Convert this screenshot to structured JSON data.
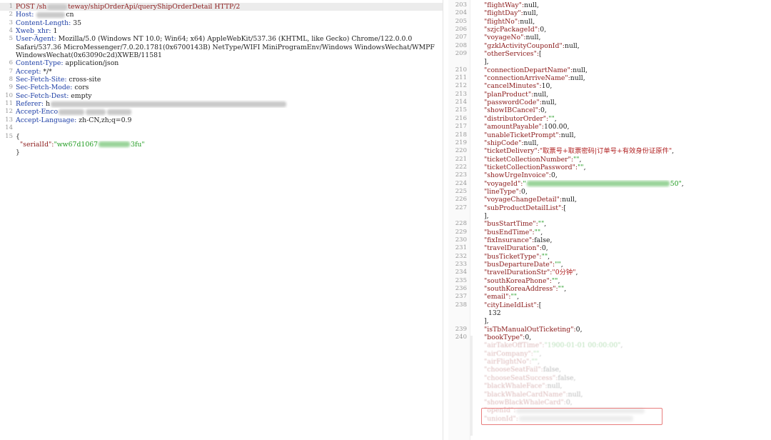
{
  "request": {
    "lines": [
      {
        "n": "1",
        "parts": [
          {
            "t": "POST /sh",
            "c": "k"
          },
          {
            "b": 28
          },
          {
            "t": "teway/shipOrderApi/queryShipOrderDetail HTTP/2",
            "c": "k"
          }
        ],
        "hl": true
      },
      {
        "n": "2",
        "parts": [
          {
            "t": "Host: ",
            "c": "hdr"
          },
          {
            "b": 40
          },
          {
            "t": "cn",
            "c": ""
          }
        ]
      },
      {
        "n": "3",
        "parts": [
          {
            "t": "Content-Length: ",
            "c": "hdr"
          },
          {
            "t": "35",
            "c": ""
          }
        ]
      },
      {
        "n": "4",
        "parts": [
          {
            "t": "Xweb_xhr: ",
            "c": "hdr"
          },
          {
            "t": "1",
            "c": ""
          }
        ]
      },
      {
        "n": "5",
        "parts": [
          {
            "t": "User-Agent: ",
            "c": "hdr"
          },
          {
            "t": "Mozilla/5.0 (Windows NT 10.0; Win64; x64) AppleWebKit/537.36 (KHTML, like Gecko) Chrome/122.0.0.0",
            "c": ""
          }
        ]
      },
      {
        "n": "",
        "parts": [
          {
            "t": "Safari/537.36 MicroMessenger/7.0.20.1781(0x6700143B) NetType/WIFI MiniProgramEnv/Windows WindowsWechat/WMPF",
            "c": ""
          }
        ]
      },
      {
        "n": "",
        "parts": [
          {
            "t": "WindowsWechat(0x63090c2d)XWEB/11581",
            "c": ""
          }
        ]
      },
      {
        "n": "6",
        "parts": [
          {
            "t": "Content-Type: ",
            "c": "hdr"
          },
          {
            "t": "application/json",
            "c": ""
          }
        ]
      },
      {
        "n": "7",
        "parts": [
          {
            "t": "Accept: ",
            "c": "hdr"
          },
          {
            "t": "*/*",
            "c": ""
          }
        ]
      },
      {
        "n": "8",
        "parts": [
          {
            "t": "Sec-Fetch-Site: ",
            "c": "hdr"
          },
          {
            "t": "cross-site",
            "c": ""
          }
        ]
      },
      {
        "n": "9",
        "parts": [
          {
            "t": "Sec-Fetch-Mode: ",
            "c": "hdr"
          },
          {
            "t": "cors",
            "c": ""
          }
        ]
      },
      {
        "n": "10",
        "parts": [
          {
            "t": "Sec-Fetch-Dest: ",
            "c": "hdr"
          },
          {
            "t": "empty",
            "c": ""
          }
        ]
      },
      {
        "n": "11",
        "parts": [
          {
            "t": "Referer: ",
            "c": "hdr"
          },
          {
            "t": "h",
            "c": ""
          },
          {
            "b": 330
          }
        ]
      },
      {
        "n": "12",
        "parts": [
          {
            "t": "Accept-Enco",
            "c": "hdr"
          },
          {
            "b": 36
          },
          {
            "b": 28
          },
          {
            "b": 34
          }
        ]
      },
      {
        "n": "13",
        "parts": [
          {
            "t": "Accept-Language: ",
            "c": "hdr"
          },
          {
            "t": "zh-CN,zh;q=0.9",
            "c": ""
          }
        ]
      },
      {
        "n": "14",
        "parts": []
      },
      {
        "n": "15",
        "parts": [
          {
            "t": "{",
            "c": ""
          }
        ]
      },
      {
        "n": "",
        "parts": [
          {
            "t": "  \"serialId\":",
            "c": "k"
          },
          {
            "t": "\"ww67d1067",
            "c": "s"
          },
          {
            "b": 44,
            "g": true
          },
          {
            "t": "3fu\"",
            "c": "s"
          }
        ]
      },
      {
        "n": "",
        "parts": [
          {
            "t": "}",
            "c": ""
          }
        ]
      }
    ]
  },
  "response": {
    "lines": [
      {
        "n": "203",
        "parts": [
          {
            "t": "\"flightWay\":",
            "c": "k"
          },
          {
            "t": "null,",
            "c": ""
          }
        ]
      },
      {
        "n": "204",
        "parts": [
          {
            "t": "\"flightDay\":",
            "c": "k"
          },
          {
            "t": "null,",
            "c": ""
          }
        ]
      },
      {
        "n": "205",
        "parts": [
          {
            "t": "\"flightNo\":",
            "c": "k"
          },
          {
            "t": "null,",
            "c": ""
          }
        ]
      },
      {
        "n": "206",
        "parts": [
          {
            "t": "\"szjcPackageId\":",
            "c": "k"
          },
          {
            "t": "0,",
            "c": ""
          }
        ]
      },
      {
        "n": "207",
        "parts": [
          {
            "t": "\"voyageNo\":",
            "c": "k"
          },
          {
            "t": "null,",
            "c": ""
          }
        ]
      },
      {
        "n": "208",
        "parts": [
          {
            "t": "\"gzklActivityCouponId\":",
            "c": "k"
          },
          {
            "t": "null,",
            "c": ""
          }
        ]
      },
      {
        "n": "209",
        "parts": [
          {
            "t": "\"otherServices\":",
            "c": "k"
          },
          {
            "t": "[",
            "c": ""
          }
        ]
      },
      {
        "n": "",
        "parts": [
          {
            "t": "],",
            "c": ""
          }
        ]
      },
      {
        "n": "210",
        "parts": [
          {
            "t": "\"connectionDepartName\":",
            "c": "k"
          },
          {
            "t": "null,",
            "c": ""
          }
        ]
      },
      {
        "n": "211",
        "parts": [
          {
            "t": "\"connectionArriveName\":",
            "c": "k"
          },
          {
            "t": "null,",
            "c": ""
          }
        ]
      },
      {
        "n": "212",
        "parts": [
          {
            "t": "\"cancelMinutes\":",
            "c": "k"
          },
          {
            "t": "10,",
            "c": ""
          }
        ]
      },
      {
        "n": "213",
        "parts": [
          {
            "t": "\"planProduct\":",
            "c": "k"
          },
          {
            "t": "null,",
            "c": ""
          }
        ]
      },
      {
        "n": "214",
        "parts": [
          {
            "t": "\"passwordCode\":",
            "c": "k"
          },
          {
            "t": "null,",
            "c": ""
          }
        ]
      },
      {
        "n": "215",
        "parts": [
          {
            "t": "\"showIBCancel\":",
            "c": "k"
          },
          {
            "t": "0,",
            "c": ""
          }
        ]
      },
      {
        "n": "216",
        "parts": [
          {
            "t": "\"distributorOrder\":",
            "c": "k"
          },
          {
            "t": "\"\"",
            "c": "s"
          },
          {
            "t": ",",
            "c": ""
          }
        ]
      },
      {
        "n": "217",
        "parts": [
          {
            "t": "\"amountPayable\":",
            "c": "k"
          },
          {
            "t": "100.00,",
            "c": ""
          }
        ]
      },
      {
        "n": "218",
        "parts": [
          {
            "t": "\"unableTicketPrompt\":",
            "c": "k"
          },
          {
            "t": "null,",
            "c": ""
          }
        ]
      },
      {
        "n": "219",
        "parts": [
          {
            "t": "\"shipCode\":",
            "c": "k"
          },
          {
            "t": "null,",
            "c": ""
          }
        ]
      },
      {
        "n": "220",
        "parts": [
          {
            "t": "\"ticketDelivery\":",
            "c": "k"
          },
          {
            "t": "\"取票号+取票密码|订单号+有效身份证原件\"",
            "c": "cn"
          },
          {
            "t": ",",
            "c": ""
          }
        ]
      },
      {
        "n": "221",
        "parts": [
          {
            "t": "\"ticketCollectionNumber\":",
            "c": "k"
          },
          {
            "t": "\"\"",
            "c": "s"
          },
          {
            "t": ",",
            "c": ""
          }
        ]
      },
      {
        "n": "222",
        "parts": [
          {
            "t": "\"ticketCollectionPassword\":",
            "c": "k"
          },
          {
            "t": "\"\"",
            "c": "s"
          },
          {
            "t": ",",
            "c": ""
          }
        ]
      },
      {
        "n": "223",
        "parts": [
          {
            "t": "\"showUrgeInvoice\":",
            "c": "k"
          },
          {
            "t": "0,",
            "c": ""
          }
        ]
      },
      {
        "n": "224",
        "parts": [
          {
            "t": "\"voyageId\":",
            "c": "k"
          },
          {
            "t": "\"",
            "c": "s"
          },
          {
            "b": 200,
            "g": true
          },
          {
            "t": "50\"",
            "c": "s"
          },
          {
            "t": ",",
            "c": ""
          }
        ]
      },
      {
        "n": "225",
        "parts": [
          {
            "t": "\"lineType\":",
            "c": "k"
          },
          {
            "t": "0,",
            "c": ""
          }
        ]
      },
      {
        "n": "226",
        "parts": [
          {
            "t": "\"voyageChangeDetail\":",
            "c": "k"
          },
          {
            "t": "null,",
            "c": ""
          }
        ]
      },
      {
        "n": "227",
        "parts": [
          {
            "t": "\"subProductDetailList\":",
            "c": "k"
          },
          {
            "t": "[",
            "c": ""
          }
        ]
      },
      {
        "n": "",
        "parts": [
          {
            "t": "],",
            "c": ""
          }
        ]
      },
      {
        "n": "228",
        "parts": [
          {
            "t": "\"busStartTime\":",
            "c": "k"
          },
          {
            "t": "\"\"",
            "c": "s"
          },
          {
            "t": ",",
            "c": ""
          }
        ]
      },
      {
        "n": "229",
        "parts": [
          {
            "t": "\"busEndTime\":",
            "c": "k"
          },
          {
            "t": "\"\"",
            "c": "s"
          },
          {
            "t": ",",
            "c": ""
          }
        ]
      },
      {
        "n": "230",
        "parts": [
          {
            "t": "\"fixInsurance\":",
            "c": "k"
          },
          {
            "t": "false,",
            "c": ""
          }
        ]
      },
      {
        "n": "231",
        "parts": [
          {
            "t": "\"travelDuration\":",
            "c": "k"
          },
          {
            "t": "0,",
            "c": ""
          }
        ]
      },
      {
        "n": "232",
        "parts": [
          {
            "t": "\"busTicketType\":",
            "c": "k"
          },
          {
            "t": "\"\"",
            "c": "s"
          },
          {
            "t": ",",
            "c": ""
          }
        ]
      },
      {
        "n": "233",
        "parts": [
          {
            "t": "\"busDepartureDate\":",
            "c": "k"
          },
          {
            "t": "\"\"",
            "c": "s"
          },
          {
            "t": ",",
            "c": ""
          }
        ]
      },
      {
        "n": "234",
        "parts": [
          {
            "t": "\"travelDurationStr\":",
            "c": "k"
          },
          {
            "t": "\"0分钟\"",
            "c": "cn"
          },
          {
            "t": ",",
            "c": ""
          }
        ]
      },
      {
        "n": "235",
        "parts": [
          {
            "t": "\"southKoreaPhone\":",
            "c": "k"
          },
          {
            "t": "\"\"",
            "c": "s"
          },
          {
            "t": ",",
            "c": ""
          }
        ]
      },
      {
        "n": "236",
        "parts": [
          {
            "t": "\"southKoreaAddress\":",
            "c": "k"
          },
          {
            "t": "\"\"",
            "c": "s"
          },
          {
            "t": ",",
            "c": ""
          }
        ]
      },
      {
        "n": "237",
        "parts": [
          {
            "t": "\"email\":",
            "c": "k"
          },
          {
            "t": "\"\"",
            "c": "s"
          },
          {
            "t": ",",
            "c": ""
          }
        ]
      },
      {
        "n": "238",
        "parts": [
          {
            "t": "\"cityLineIdList\":",
            "c": "k"
          },
          {
            "t": "[",
            "c": ""
          }
        ]
      },
      {
        "n": "",
        "parts": [
          {
            "t": "  132",
            "c": ""
          }
        ]
      },
      {
        "n": "",
        "parts": [
          {
            "t": "],",
            "c": ""
          }
        ]
      },
      {
        "n": "239",
        "parts": [
          {
            "t": "\"isTbManualOutTicketing\":",
            "c": "k"
          },
          {
            "t": "0,",
            "c": ""
          }
        ]
      },
      {
        "n": "240",
        "parts": [
          {
            "t": "\"bookType\":",
            "c": "k"
          },
          {
            "t": "0,",
            "c": ""
          }
        ]
      },
      {
        "n": "",
        "faded": true,
        "parts": [
          {
            "t": "\"airTakeOffTime\":",
            "c": "k"
          },
          {
            "t": "\"1900-01-01 00:00:00\"",
            "c": "s"
          },
          {
            "t": ",",
            "c": ""
          }
        ]
      },
      {
        "n": "",
        "faded": true,
        "parts": [
          {
            "t": "\"airCompany\":",
            "c": "k"
          },
          {
            "t": "\"\"",
            "c": "s"
          },
          {
            "t": ",",
            "c": ""
          }
        ]
      },
      {
        "n": "",
        "faded": true,
        "parts": [
          {
            "t": "\"airFlightNo\":",
            "c": "k"
          },
          {
            "t": "\"\"",
            "c": "s"
          },
          {
            "t": ",",
            "c": ""
          }
        ]
      },
      {
        "n": "",
        "faded": true,
        "parts": [
          {
            "t": "\"chooseSeatFail\":",
            "c": "k"
          },
          {
            "t": "false,",
            "c": ""
          }
        ]
      },
      {
        "n": "",
        "faded": true,
        "parts": [
          {
            "t": "\"chooseSeatSuccess\":",
            "c": "k"
          },
          {
            "t": "false,",
            "c": ""
          }
        ]
      },
      {
        "n": "",
        "faded": true,
        "parts": [
          {
            "t": "\"blackWhaleFace\":",
            "c": "k"
          },
          {
            "t": "null,",
            "c": ""
          }
        ]
      },
      {
        "n": "",
        "faded": true,
        "parts": [
          {
            "t": "\"blackWhaleCardName\":",
            "c": "k"
          },
          {
            "t": "null,",
            "c": ""
          }
        ]
      },
      {
        "n": "",
        "faded": true,
        "parts": [
          {
            "t": "\"showBlackWhaleCard\":",
            "c": "k"
          },
          {
            "t": "0,",
            "c": ""
          }
        ]
      },
      {
        "n": "",
        "faded": true,
        "parts": [
          {
            "t": "\"openId\":",
            "c": "k"
          },
          {
            "b": 180
          }
        ]
      },
      {
        "n": "",
        "faded": true,
        "parts": [
          {
            "t": "\"unionId\":",
            "c": "k"
          },
          {
            "b": 160
          }
        ]
      }
    ]
  }
}
